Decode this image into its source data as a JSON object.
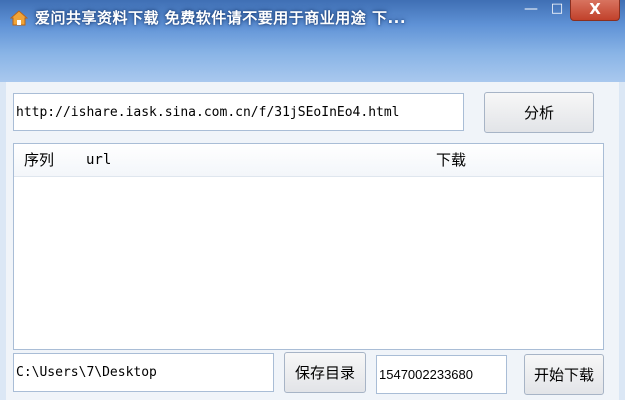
{
  "window": {
    "title": "爱问共享资料下载 免费软件请不要用于商业用途 下...",
    "minimize_glyph": "—",
    "maximize_glyph": "□",
    "close_glyph": "X",
    "app_icon": "house-icon"
  },
  "url_field": {
    "value": "http://ishare.iask.sina.com.cn/f/31jSEoInEo4.html"
  },
  "analyze_button": {
    "label": "分析"
  },
  "list": {
    "columns": [
      "序列",
      "url",
      "下载"
    ],
    "rows": []
  },
  "path_field": {
    "value": "C:\\Users\\7\\Desktop"
  },
  "save_dir_button": {
    "label": "保存目录"
  },
  "id_field": {
    "value": "1547002233680"
  },
  "start_button": {
    "label": "开始下载"
  },
  "colors": {
    "titlebar": "#5f92d6",
    "close_button": "#c1412b",
    "border": "#a9bdd6"
  }
}
